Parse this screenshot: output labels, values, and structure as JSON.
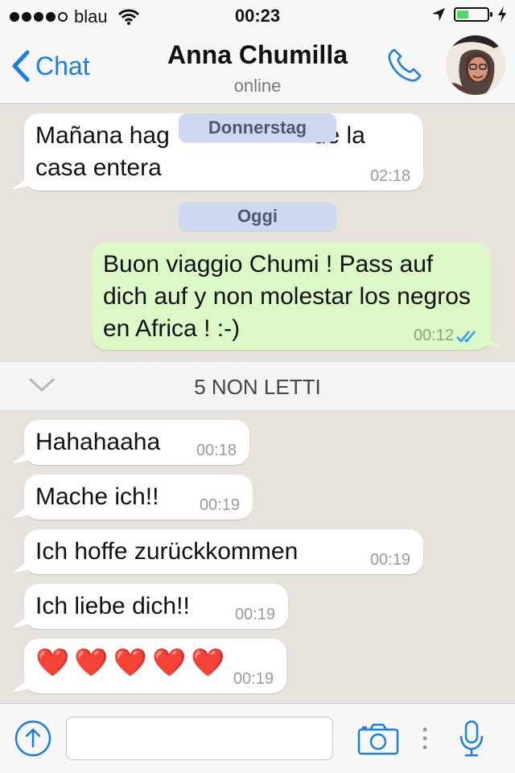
{
  "status": {
    "carrier": "blau",
    "time": "00:23"
  },
  "header": {
    "back_label": "Chat",
    "contact_name": "Anna Chumilla",
    "presence": "online",
    "accent_color": "#1a7fe0"
  },
  "messages_before": [
    {
      "direction": "in",
      "text_line1": "Mañana hag",
      "text_line1_end": "de la",
      "text_line2": "casa entera",
      "time": "02:18"
    }
  ],
  "day_labels": {
    "sticky": "Donnerstag",
    "today": "Oggi"
  },
  "outgoing": {
    "text": "Buon viaggio Chumi ! Pass auf dich auf y non molestar los negros en Africa ! :-)",
    "time": "00:12",
    "status": "read"
  },
  "unread_banner": "5 NON LETTI",
  "messages": [
    {
      "text": "Hahahaaha",
      "time": "00:18"
    },
    {
      "text": "Mache ich!!",
      "time": "00:19"
    },
    {
      "text": "Ich hoffe zurückkommen",
      "time": "00:19"
    },
    {
      "text": "Ich liebe dich!!",
      "time": "00:19"
    },
    {
      "text": "❤️❤️❤️❤️❤️",
      "time": "00:19"
    }
  ],
  "composer": {
    "placeholder": ""
  },
  "colors": {
    "incoming_bubble": "#ffffff",
    "outgoing_bubble": "#dcf8c6",
    "background": "#e6e2dc",
    "day_pill": "#cdd9f4"
  }
}
